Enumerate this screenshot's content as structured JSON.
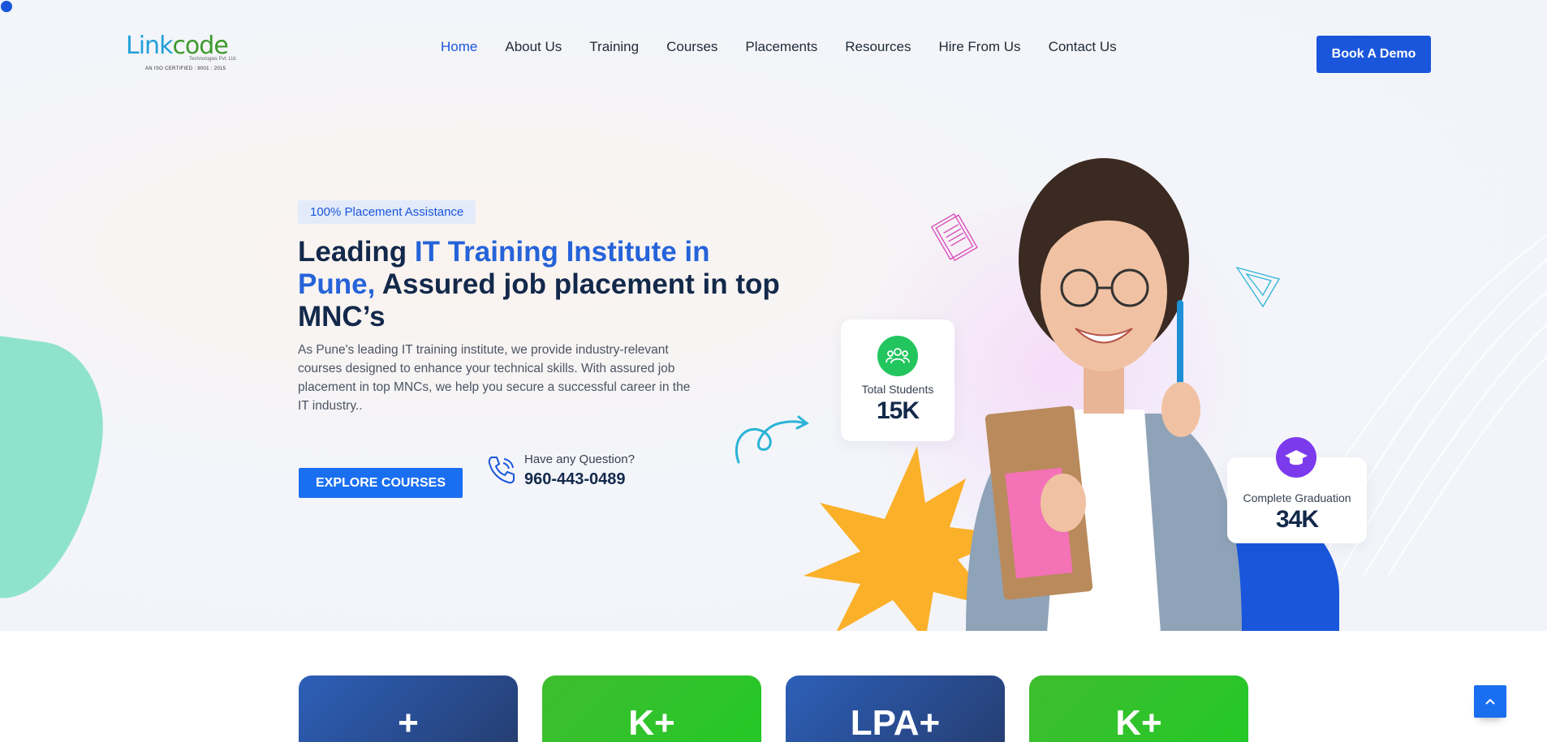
{
  "logo": {
    "main_a": "Link",
    "main_b": "code",
    "sub": "Technologies Pvt. Ltd.",
    "iso": "AN ISO CERTIFIED : 9001 : 2015"
  },
  "nav": [
    {
      "label": "Home",
      "active": true
    },
    {
      "label": "About Us"
    },
    {
      "label": "Training"
    },
    {
      "label": "Courses"
    },
    {
      "label": "Placements"
    },
    {
      "label": "Resources"
    },
    {
      "label": "Hire From Us"
    },
    {
      "label": "Contact Us"
    }
  ],
  "header": {
    "demo_label": "Book A Demo"
  },
  "hero": {
    "badge": "100% Placement Assistance",
    "headline_1": "Leading ",
    "headline_highlight": "IT Training Institute in Pune,",
    "headline_2": " Assured job placement in top MNC’s",
    "description": "As Pune's leading IT training institute, we provide industry-relevant courses designed to enhance your technical skills. With assured job placement in top MNCs, we help you secure a successful career in the IT industry..",
    "explore_label": "EXPLORE COURSES",
    "question": "Have any Question?",
    "phone": "960-443-0489"
  },
  "stats": {
    "students_label": "Total Students",
    "students_value": "15K",
    "grad_label": "Complete Graduation",
    "grad_value": "34K"
  },
  "tiles": [
    "+",
    "K+",
    "LPA+",
    "K+"
  ],
  "colors": {
    "primary": "#1a56db",
    "navy": "#13294b",
    "green": "#22c55e",
    "purple": "#7c3aed",
    "orange": "#fbb02a"
  },
  "icons": {
    "phone": "phone-icon",
    "students": "users-icon",
    "graduation": "graduation-cap-icon",
    "scroll_top": "chevron-up-icon"
  }
}
